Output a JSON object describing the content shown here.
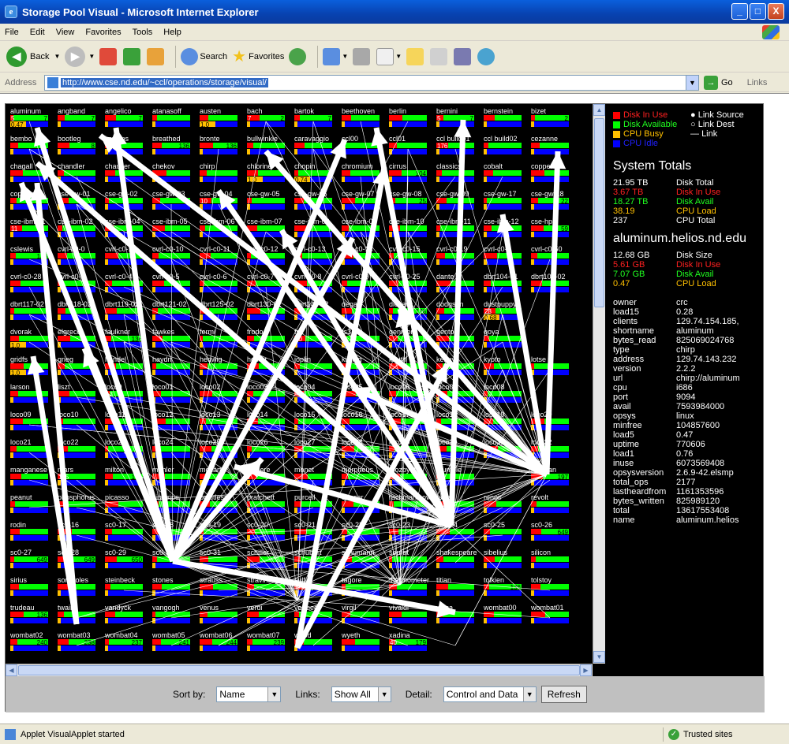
{
  "window": {
    "title": "Storage Pool Visual - Microsoft Internet Explorer",
    "minimize": "_",
    "maximize": "□",
    "close": "X"
  },
  "menu": [
    "File",
    "Edit",
    "View",
    "Favorites",
    "Tools",
    "Help"
  ],
  "toolbar": {
    "back": "Back",
    "search": "Search",
    "favorites": "Favorites"
  },
  "address": {
    "label": "Address",
    "url": "http://www.cse.nd.edu/~ccl/operations/storage/visual/",
    "go": "Go",
    "links": "Links"
  },
  "legend": {
    "disk_in_use": "Disk In Use",
    "disk_available": "Disk Available",
    "cpu_busy": "CPU Busy",
    "cpu_idle": "CPU Idle",
    "link_source": "Link Source",
    "link_dest": "Link Dest",
    "link": "Link",
    "colors": {
      "in_use": "#ff0000",
      "avail": "#00ff00",
      "busy": "#ffc000",
      "idle": "#0000ff"
    }
  },
  "system_totals": {
    "title": "System Totals",
    "rows": [
      {
        "value": "21.95 TB",
        "label": "Disk Total",
        "color": "#ffffff"
      },
      {
        "value": "3.67 TB",
        "label": "Disk In Use",
        "color": "#ff2020"
      },
      {
        "value": "18.27 TB",
        "label": "Disk Avail",
        "color": "#20ff20"
      },
      {
        "value": "38.19",
        "label": "CPU Load",
        "color": "#ffc000"
      },
      {
        "value": "237",
        "label": "CPU Total",
        "color": "#ffffff"
      }
    ]
  },
  "host": {
    "title": "aluminum.helios.nd.edu",
    "rows": [
      {
        "value": "12.68 GB",
        "label": "Disk Size",
        "color": "#ffffff"
      },
      {
        "value": "5.61 GB",
        "label": "Disk In Use",
        "color": "#ff2020"
      },
      {
        "value": "7.07 GB",
        "label": "Disk Avail",
        "color": "#20ff20"
      },
      {
        "value": "0.47",
        "label": "CPU Load",
        "color": "#ffc000"
      }
    ],
    "props": [
      [
        "owner",
        "crc"
      ],
      [
        "load15",
        "0.28"
      ],
      [
        "clients",
        "129.74.154.185,"
      ],
      [
        "shortname",
        "aluminum"
      ],
      [
        "bytes_read",
        "825069024768"
      ],
      [
        "type",
        "chirp"
      ],
      [
        "address",
        "129.74.143.232"
      ],
      [
        "version",
        "2.2.2"
      ],
      [
        "url",
        "chirp://aluminum"
      ],
      [
        "cpu",
        "i686"
      ],
      [
        "port",
        "9094"
      ],
      [
        "avail",
        "7593984000"
      ],
      [
        "opsys",
        "linux"
      ],
      [
        "minfree",
        "104857600"
      ],
      [
        "load5",
        "0.47"
      ],
      [
        "uptime",
        "770606"
      ],
      [
        "load1",
        "0.76"
      ],
      [
        "inuse",
        "6073569408"
      ],
      [
        "opsysversion",
        "2.6.9-42.elsmp"
      ],
      [
        "total_ops",
        "2177"
      ],
      [
        "lastheardfrom",
        "1161353596"
      ],
      [
        "bytes_written",
        "825989120"
      ],
      [
        "total",
        "13617553408"
      ],
      [
        "name",
        "aluminum.helios"
      ]
    ]
  },
  "controls": {
    "sort_label": "Sort by:",
    "sort_value": "Name",
    "links_label": "Links:",
    "links_value": "Show All",
    "detail_label": "Detail:",
    "detail_value": "Control and Data",
    "refresh": "Refresh"
  },
  "status": {
    "text": "Applet VisualApplet started",
    "zone": "Trusted sites"
  },
  "nodes": [
    [
      "aluminum",
      "5",
      "7",
      "0.47"
    ],
    [
      "angband",
      "",
      "7",
      ""
    ],
    [
      "angelico",
      "",
      "7",
      ""
    ],
    [
      "atanasoff",
      "",
      "",
      ""
    ],
    [
      "austen",
      "",
      "",
      "1.0"
    ],
    [
      "bach",
      "7",
      "2",
      ""
    ],
    [
      "bartok",
      "",
      "7",
      ""
    ],
    [
      "beethoven",
      "",
      "",
      ""
    ],
    [
      "berlin",
      "",
      "",
      ""
    ],
    [
      "bernini",
      "5",
      "7",
      ""
    ],
    [
      "bernstein",
      "",
      "",
      ""
    ],
    [
      "bizet",
      "",
      "2",
      ""
    ],
    [
      "bembo",
      "",
      "",
      ""
    ],
    [
      "bootleg",
      "",
      "8",
      ""
    ],
    [
      "brahms",
      "",
      "",
      ""
    ],
    [
      "breathed",
      "",
      "136",
      ""
    ],
    [
      "bronte",
      "",
      "136",
      ""
    ],
    [
      "bullwinkle",
      "",
      "",
      ""
    ],
    [
      "caravaggio",
      "",
      "",
      ""
    ],
    [
      "ccl00",
      "",
      "",
      ""
    ],
    [
      "ccl01",
      "",
      "",
      ""
    ],
    [
      "ccl build01",
      "176",
      "",
      ""
    ],
    [
      "ccl build02",
      "",
      "",
      ""
    ],
    [
      "cezanne",
      "",
      "",
      ""
    ],
    [
      "chagall",
      "",
      "",
      ""
    ],
    [
      "chandler",
      "",
      "",
      ""
    ],
    [
      "chaucer",
      "",
      "",
      ""
    ],
    [
      "chekov",
      "",
      "",
      ""
    ],
    [
      "chirp",
      "",
      "",
      ""
    ],
    [
      "chlorine",
      "",
      "",
      "1.0"
    ],
    [
      "chopin",
      "",
      "",
      "0.74"
    ],
    [
      "chromium",
      "",
      "",
      ""
    ],
    [
      "cirrus",
      "",
      "104",
      ""
    ],
    [
      "classics",
      "",
      "",
      ""
    ],
    [
      "cobalt",
      "",
      "",
      ""
    ],
    [
      "copper",
      "",
      "",
      ""
    ],
    [
      "copland",
      "",
      "",
      ""
    ],
    [
      "cse-gw-01",
      "",
      "",
      ""
    ],
    [
      "cse-gw-02",
      "",
      "",
      ""
    ],
    [
      "cse-gw-03",
      "",
      "",
      ""
    ],
    [
      "cse-gw-04",
      "10",
      "",
      ""
    ],
    [
      "cse-gw-05",
      "",
      "",
      ""
    ],
    [
      "cse-gw-06",
      "",
      "",
      ""
    ],
    [
      "cse-gw-07",
      "",
      "",
      ""
    ],
    [
      "cse-gw-08",
      "",
      "25",
      ""
    ],
    [
      "cse-gw-09",
      "",
      "",
      ""
    ],
    [
      "cse-gw-17",
      "",
      "",
      ""
    ],
    [
      "cse-gw-18",
      "",
      "22",
      ""
    ],
    [
      "cse-ibm-01",
      "11",
      "",
      ""
    ],
    [
      "cse-ibm-02",
      "",
      "",
      ""
    ],
    [
      "cse-ibm-04",
      "",
      "",
      ""
    ],
    [
      "cse-ibm-05",
      "",
      "",
      ""
    ],
    [
      "cse-ibm-06",
      "",
      "",
      ""
    ],
    [
      "cse-ibm-07",
      "",
      "",
      ""
    ],
    [
      "cse-ibm-08",
      "",
      "",
      ""
    ],
    [
      "cse-ibm-09",
      "",
      "",
      ""
    ],
    [
      "cse-ibm-10",
      "",
      "",
      ""
    ],
    [
      "cse-ibm-11",
      "",
      "",
      ""
    ],
    [
      "cse-ibm-12",
      "",
      "",
      ""
    ],
    [
      "cse-hp",
      "",
      "59",
      ""
    ],
    [
      "cslewis",
      "",
      "136",
      ""
    ],
    [
      "cvrl-c0-0",
      "",
      "",
      ""
    ],
    [
      "cvrl-c0-1",
      "",
      "",
      ""
    ],
    [
      "cvrl-c0-10",
      "",
      "",
      ""
    ],
    [
      "cvrl-c0-11",
      "",
      "",
      ""
    ],
    [
      "cvrl-c0-12",
      "",
      "",
      ""
    ],
    [
      "cvrl-c0-13",
      "",
      "",
      ""
    ],
    [
      "cvrl-c0-14",
      "",
      "",
      ""
    ],
    [
      "cvrl-c0-15",
      "",
      "",
      ""
    ],
    [
      "cvrl-c0-19",
      "",
      "",
      ""
    ],
    [
      "cvrl-c0-2",
      "",
      "",
      ""
    ],
    [
      "cvrl-c0-50",
      "",
      "",
      ""
    ],
    [
      "cvrl-c0-28",
      "",
      "",
      ""
    ],
    [
      "cvrl-c0-3",
      "",
      "",
      ""
    ],
    [
      "cvrl-c0-4",
      "",
      "",
      ""
    ],
    [
      "cvrl-c0-5",
      "",
      "",
      ""
    ],
    [
      "cvrl-c0-6",
      "",
      "",
      ""
    ],
    [
      "cvrl-c0-7",
      "",
      "",
      ""
    ],
    [
      "cvrl-c0-8",
      "",
      "",
      ""
    ],
    [
      "cvrl-c0-9",
      "",
      "",
      ""
    ],
    [
      "cvrl-c0-25",
      "",
      "",
      ""
    ],
    [
      "dante",
      "",
      "",
      ""
    ],
    [
      "dbrt104-01",
      "",
      "",
      ""
    ],
    [
      "dbrt102-02",
      "",
      "",
      ""
    ],
    [
      "dbrt117-02",
      "",
      "",
      ""
    ],
    [
      "dbrt118-02",
      "",
      "",
      ""
    ],
    [
      "dbrt119-02",
      "",
      "",
      ""
    ],
    [
      "dbrt121-02",
      "",
      "",
      ""
    ],
    [
      "dbrt125-02",
      "",
      "",
      ""
    ],
    [
      "dbrt130-02",
      "",
      "",
      ""
    ],
    [
      "dbrt140-02",
      "",
      "",
      ""
    ],
    [
      "degas",
      "",
      "",
      ""
    ],
    [
      "dickens",
      "",
      "136",
      ""
    ],
    [
      "dodgson",
      "",
      "",
      ""
    ],
    [
      "dustpuppy",
      "23",
      "",
      "0.68"
    ],
    [
      "",
      "",
      "",
      ""
    ],
    [
      "dvorak",
      "",
      "",
      "1.0"
    ],
    [
      "elgreco",
      "",
      "",
      ""
    ],
    [
      "faulkner",
      "",
      "136",
      ""
    ],
    [
      "fawkes",
      "",
      "",
      ""
    ],
    [
      "fermi",
      "",
      "",
      ""
    ],
    [
      "frodo",
      "",
      "",
      ""
    ],
    [
      "fs2",
      "10",
      "",
      ""
    ],
    [
      "fs3",
      "",
      "",
      ""
    ],
    [
      "genmon",
      "",
      "",
      ""
    ],
    [
      "gentoo",
      "",
      "",
      ""
    ],
    [
      "goya",
      "",
      "",
      ""
    ],
    [
      "",
      "",
      "",
      ""
    ],
    [
      "gridfs",
      "",
      "",
      "1.0"
    ],
    [
      "grieg",
      "",
      "",
      ""
    ],
    [
      "handel",
      "",
      "",
      ""
    ],
    [
      "haydn",
      "",
      "",
      ""
    ],
    [
      "hedwig",
      "",
      "",
      ""
    ],
    [
      "homer",
      "",
      "",
      ""
    ],
    [
      "joplin",
      "",
      "",
      ""
    ],
    [
      "kipling",
      "",
      "",
      ""
    ],
    [
      "knuth",
      "",
      "",
      ""
    ],
    [
      "kenny",
      "",
      "",
      ""
    ],
    [
      "kyoto",
      "",
      "",
      ""
    ],
    [
      "lotse",
      "",
      "",
      ""
    ],
    [
      "larson",
      "",
      "",
      ""
    ],
    [
      "liszt",
      "",
      "",
      ""
    ],
    [
      "loco0",
      "13",
      "",
      ""
    ],
    [
      "loco01",
      "",
      "",
      ""
    ],
    [
      "loco02",
      "",
      "",
      ""
    ],
    [
      "loco03",
      "",
      "",
      ""
    ],
    [
      "loco04",
      "",
      "",
      ""
    ],
    [
      "loco05",
      "",
      "",
      ""
    ],
    [
      "loco06",
      "",
      "",
      ""
    ],
    [
      "loco07",
      "",
      "",
      ""
    ],
    [
      "loco08",
      "",
      "",
      ""
    ],
    [
      "",
      "",
      "",
      ""
    ],
    [
      "loco09",
      "",
      "",
      ""
    ],
    [
      "loco10",
      "",
      "",
      ""
    ],
    [
      "loco11",
      "",
      "",
      ""
    ],
    [
      "loco12",
      "",
      "",
      ""
    ],
    [
      "loco13",
      "",
      "",
      ""
    ],
    [
      "loco14",
      "",
      "",
      ""
    ],
    [
      "loco15",
      "",
      "",
      ""
    ],
    [
      "loco16",
      "",
      "",
      ""
    ],
    [
      "loco17",
      "",
      "",
      ""
    ],
    [
      "loco18",
      "",
      "",
      ""
    ],
    [
      "loco19",
      "",
      "",
      ""
    ],
    [
      "loco20",
      "",
      "",
      ""
    ],
    [
      "loco21",
      "",
      "",
      ""
    ],
    [
      "loco22",
      "",
      "",
      ""
    ],
    [
      "loco23",
      "",
      "",
      ""
    ],
    [
      "loco24",
      "",
      "",
      ""
    ],
    [
      "loco25",
      "",
      "",
      ""
    ],
    [
      "loco26",
      "",
      "",
      ""
    ],
    [
      "loco27",
      "",
      "",
      ""
    ],
    [
      "loco28",
      "",
      "",
      ""
    ],
    [
      "loco29",
      "",
      "",
      ""
    ],
    [
      "loco30",
      "",
      "",
      ""
    ],
    [
      "loco31",
      "",
      "",
      ""
    ],
    [
      "loco32",
      "",
      "",
      ""
    ],
    [
      "manganese",
      "",
      "",
      ""
    ],
    [
      "mars",
      "105",
      "",
      ""
    ],
    [
      "milton",
      "",
      "136",
      ""
    ],
    [
      "mahler",
      "",
      "",
      ""
    ],
    [
      "mozart",
      "",
      "",
      ""
    ],
    [
      "moliere",
      "",
      "",
      ""
    ],
    [
      "monet",
      "",
      "",
      ""
    ],
    [
      "morpheus",
      "",
      "",
      ""
    ],
    [
      "mozbyaf",
      "",
      "",
      ""
    ],
    [
      "mumble",
      "",
      "",
      ""
    ],
    [
      "",
      "",
      "",
      ""
    ],
    [
      "munyan",
      "",
      "197",
      ""
    ],
    [
      "peanut",
      "",
      "",
      ""
    ],
    [
      "phosphorus",
      "",
      "",
      ""
    ],
    [
      "picasso",
      "",
      "",
      ""
    ],
    [
      "pinstripe",
      "",
      "",
      ""
    ],
    [
      "pointless",
      "",
      "",
      ""
    ],
    [
      "pratchett",
      "",
      "",
      ""
    ],
    [
      "purcell",
      "",
      "",
      ""
    ],
    [
      "quasar",
      "",
      "",
      ""
    ],
    [
      "rachmaninov",
      "",
      "",
      ""
    ],
    [
      "ravel",
      "",
      "",
      ""
    ],
    [
      "renoir",
      "",
      "",
      ""
    ],
    [
      "revolt",
      "",
      "",
      ""
    ],
    [
      "rodin",
      "",
      "",
      ""
    ],
    [
      "sc0-16",
      "",
      "",
      ""
    ],
    [
      "sc0-17",
      "",
      "",
      ""
    ],
    [
      "sc0-18",
      "",
      "",
      ""
    ],
    [
      "sc0-19",
      "",
      "",
      ""
    ],
    [
      "sc0-20",
      "",
      "",
      ""
    ],
    [
      "sc0-21",
      "",
      "",
      ""
    ],
    [
      "sc0-22",
      "",
      "",
      ""
    ],
    [
      "sc0-23",
      "",
      "",
      ""
    ],
    [
      "sc0-24",
      "",
      "",
      ""
    ],
    [
      "sc0-25",
      "",
      "",
      ""
    ],
    [
      "sc0-26",
      "",
      "649",
      ""
    ],
    [
      "sc0-27",
      "",
      "649",
      ""
    ],
    [
      "sc0-28",
      "",
      "649",
      ""
    ],
    [
      "sc0-29",
      "",
      "650",
      ""
    ],
    [
      "sc0-30",
      "",
      "",
      ""
    ],
    [
      "sc0-31",
      "",
      "",
      ""
    ],
    [
      "schiller",
      "",
      "",
      ""
    ],
    [
      "schubert",
      "",
      "",
      ""
    ],
    [
      "schumann",
      "",
      "",
      ""
    ],
    [
      "seurat",
      "",
      "",
      ""
    ],
    [
      "shakespeare",
      "",
      "",
      ""
    ],
    [
      "sibelius",
      "",
      "",
      ""
    ],
    [
      "silicon",
      "",
      "",
      ""
    ],
    [
      "sirius",
      "",
      "",
      ""
    ],
    [
      "sonoroles",
      "",
      "",
      ""
    ],
    [
      "steinbeck",
      "",
      "",
      ""
    ],
    [
      "stones",
      "",
      "",
      ""
    ],
    [
      "strauss",
      "",
      "",
      ""
    ],
    [
      "stravinsky",
      "",
      "",
      ""
    ],
    [
      "sulfur",
      "",
      "",
      ""
    ],
    [
      "tagore",
      "",
      "",
      ""
    ],
    [
      "thermometer",
      "",
      "",
      ""
    ],
    [
      "titian",
      "",
      "",
      ""
    ],
    [
      "tolkien",
      "",
      "136",
      ""
    ],
    [
      "tolstoy",
      "",
      "",
      ""
    ],
    [
      "trudeau",
      "",
      "136",
      ""
    ],
    [
      "twain",
      "",
      "",
      ""
    ],
    [
      "vandyck",
      "",
      "",
      ""
    ],
    [
      "vangogh",
      "",
      "",
      ""
    ],
    [
      "venus",
      "",
      "",
      ""
    ],
    [
      "verdi",
      "",
      "",
      ""
    ],
    [
      "vermeer",
      "",
      "",
      ""
    ],
    [
      "virgil",
      "",
      "",
      ""
    ],
    [
      "vivaldi",
      "",
      "",
      ""
    ],
    [
      "wasa",
      "",
      "",
      ""
    ],
    [
      "wombat00",
      "",
      "",
      ""
    ],
    [
      "wombat01",
      "",
      "",
      ""
    ],
    [
      "wombat02",
      "",
      "240",
      ""
    ],
    [
      "wombat03",
      "",
      "238",
      ""
    ],
    [
      "wombat04",
      "",
      "237",
      ""
    ],
    [
      "wombat05",
      "",
      "241",
      ""
    ],
    [
      "wombat06",
      "",
      "244",
      ""
    ],
    [
      "wombat07",
      "",
      "239",
      ""
    ],
    [
      "wood",
      "5",
      "",
      ""
    ],
    [
      "wyeth",
      "",
      "",
      ""
    ],
    [
      "xadina",
      "40",
      "179",
      ""
    ],
    [
      "",
      "",
      "",
      ""
    ],
    [
      "",
      "",
      "",
      ""
    ],
    [
      "",
      "",
      "",
      ""
    ]
  ]
}
